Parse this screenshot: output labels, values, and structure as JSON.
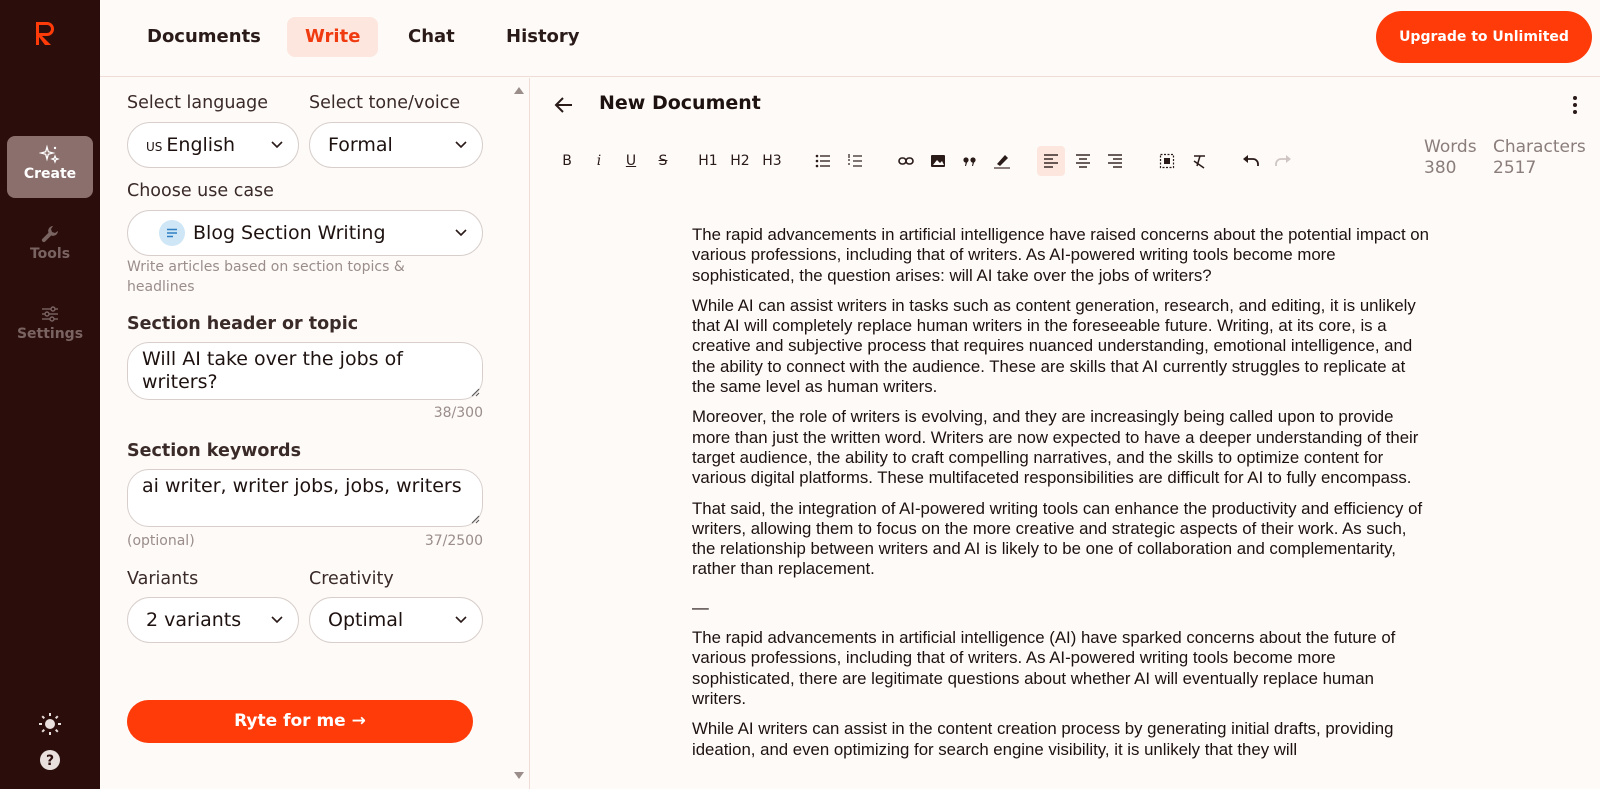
{
  "rail": {
    "items": [
      {
        "label": "Create",
        "icon": "sparkles-icon"
      },
      {
        "label": "Tools",
        "icon": "wrench-icon"
      },
      {
        "label": "Settings",
        "icon": "sliders-icon"
      }
    ]
  },
  "nav": {
    "tabs": [
      "Documents",
      "Write",
      "Chat",
      "History"
    ],
    "active": "Write",
    "upgrade_label": "Upgrade to Unlimited"
  },
  "form": {
    "language_label": "Select language",
    "language_flag": "US",
    "language_value": "English",
    "tone_label": "Select tone/voice",
    "tone_value": "Formal",
    "use_case_label": "Choose use case",
    "use_case_value": "Blog Section Writing",
    "use_case_hint": "Write articles based on section topics & headlines",
    "topic_label": "Section header or topic",
    "topic_value": "Will AI take over the jobs of writers?",
    "topic_counter": "38/300",
    "keywords_label": "Section keywords",
    "keywords_value": "ai writer, writer jobs, jobs, writers",
    "keywords_optional": "(optional)",
    "keywords_counter": "37/2500",
    "variants_label": "Variants",
    "variants_value": "2 variants",
    "creativity_label": "Creativity",
    "creativity_value": "Optimal",
    "submit_label": "Ryte for me →"
  },
  "editor": {
    "title": "New Document",
    "toolbar": {
      "bold": "B",
      "italic": "i",
      "underline": "U",
      "strike": "S",
      "h1": "H1",
      "h2": "H2",
      "h3": "H3"
    },
    "words_label": "Words",
    "words_value": "380",
    "chars_label": "Characters",
    "chars_value": "2517",
    "paragraphs": [
      "The rapid advancements in artificial intelligence have raised concerns about the potential impact on various professions, including that of writers. As AI-powered writing tools become more sophisticated, the question arises: will AI take over the jobs of writers?",
      "While AI can assist writers in tasks such as content generation, research, and editing, it is unlikely that AI will completely replace human writers in the foreseeable future. Writing, at its core, is a creative and subjective process that requires nuanced understanding, emotional intelligence, and the ability to connect with the audience. These are skills that AI currently struggles to replicate at the same level as human writers.",
      "Moreover, the role of writers is evolving, and they are increasingly being called upon to provide more than just the written word. Writers are now expected to have a deeper understanding of their target audience, the ability to craft compelling narratives, and the skills to optimize content for various digital platforms. These multifaceted responsibilities are difficult for AI to fully encompass.",
      "That said, the integration of AI-powered writing tools can enhance the productivity and efficiency of writers, allowing them to focus on the more creative and strategic aspects of their work. As such, the relationship between writers and AI is likely to be one of collaboration and complementarity, rather than replacement.",
      "—",
      "The rapid advancements in artificial intelligence (AI) have sparked concerns about the future of various professions, including that of writers. As AI-powered writing tools become more sophisticated, there are legitimate questions about whether AI will eventually replace human writers.",
      "While AI writers can assist in the content creation process by generating initial drafts, providing ideation, and even optimizing for search engine visibility, it is unlikely that they will"
    ]
  },
  "colors": {
    "accent": "#ff3b0a",
    "rail_bg": "#2b0e0c",
    "active_tab_bg": "#fde6de"
  }
}
